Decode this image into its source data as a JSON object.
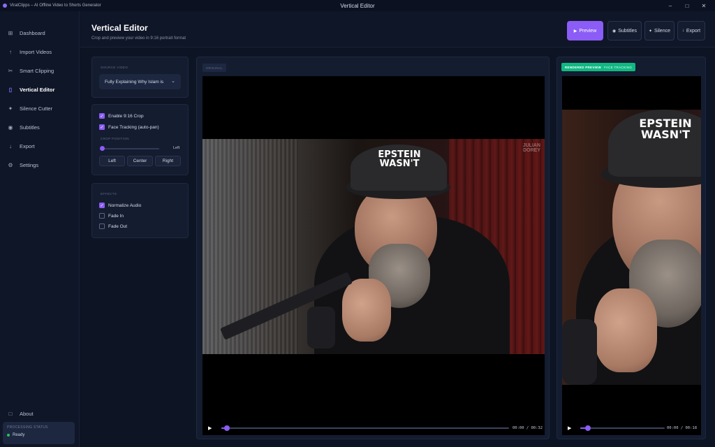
{
  "window": {
    "app_title": "ViralClipps – AI Offline Video to Shorts Generator",
    "title": "Vertical Editor",
    "controls": [
      "–",
      "□",
      "✕"
    ]
  },
  "sidebar": {
    "items": [
      {
        "label": "Dashboard",
        "icon": "grid-icon",
        "glyph": "⊞"
      },
      {
        "label": "Import Videos",
        "icon": "upload-icon",
        "glyph": "↑"
      },
      {
        "label": "Smart Clipping",
        "icon": "scissors-icon",
        "glyph": "✂"
      },
      {
        "label": "Vertical Editor",
        "icon": "phone-icon",
        "glyph": "▯",
        "active": true
      },
      {
        "label": "Silence Cutter",
        "icon": "sparkle-icon",
        "glyph": "✦"
      },
      {
        "label": "Subtitles",
        "icon": "caption-icon",
        "glyph": "◉"
      },
      {
        "label": "Export",
        "icon": "download-icon",
        "glyph": "↓"
      },
      {
        "label": "Settings",
        "icon": "gear-icon",
        "glyph": "⚙"
      }
    ],
    "about": {
      "label": "About",
      "glyph": "□"
    },
    "status": {
      "label": "Processing Status",
      "value": "Ready"
    }
  },
  "header": {
    "title": "Vertical Editor",
    "subtitle": "Crop and preview your video in 9:16 portrait format",
    "buttons": {
      "preview": {
        "label": "Preview",
        "glyph": "▶"
      },
      "subtitles": {
        "label": "Subtitles",
        "glyph": "◉"
      },
      "silence": {
        "label": "Silence",
        "glyph": "✦"
      },
      "export": {
        "label": "Export",
        "glyph": "↓"
      }
    }
  },
  "source": {
    "label": "Source Video",
    "selected": "Fully Explaining Why Islam is",
    "chevron": "⌄"
  },
  "crop": {
    "enable_crop": {
      "label": "Enable 9:16 Crop",
      "checked": true
    },
    "face_tracking": {
      "label": "Face Tracking (auto-pan)",
      "checked": true
    },
    "position_label": "Crop Position",
    "position_value": "Left",
    "position_fraction": 0,
    "buttons": [
      "Left",
      "Center",
      "Right"
    ]
  },
  "effects": {
    "label": "Effects",
    "items": [
      {
        "label": "Normalize Audio",
        "checked": true
      },
      {
        "label": "Fade In",
        "checked": false
      },
      {
        "label": "Fade Out",
        "checked": false
      }
    ]
  },
  "original_preview": {
    "tag": "Original",
    "watermark_line1": "JULIAN",
    "watermark_line2": "DOREY",
    "cap_line1": "EPSTEIN",
    "cap_line2": "WASN'T",
    "time": "00:00 / 00:32",
    "progress": 0.02
  },
  "rendered_preview": {
    "tag": "Rendered Preview",
    "tag_sub": "Face Tracking",
    "cap_line1": "EPSTEIN",
    "cap_line2": "WASN'T",
    "time": "00:00 / 00:18",
    "progress": 0.09
  },
  "colors": {
    "accent": "#8b5cf6",
    "render_tag": "#10b981",
    "status_ok": "#22c55e"
  }
}
